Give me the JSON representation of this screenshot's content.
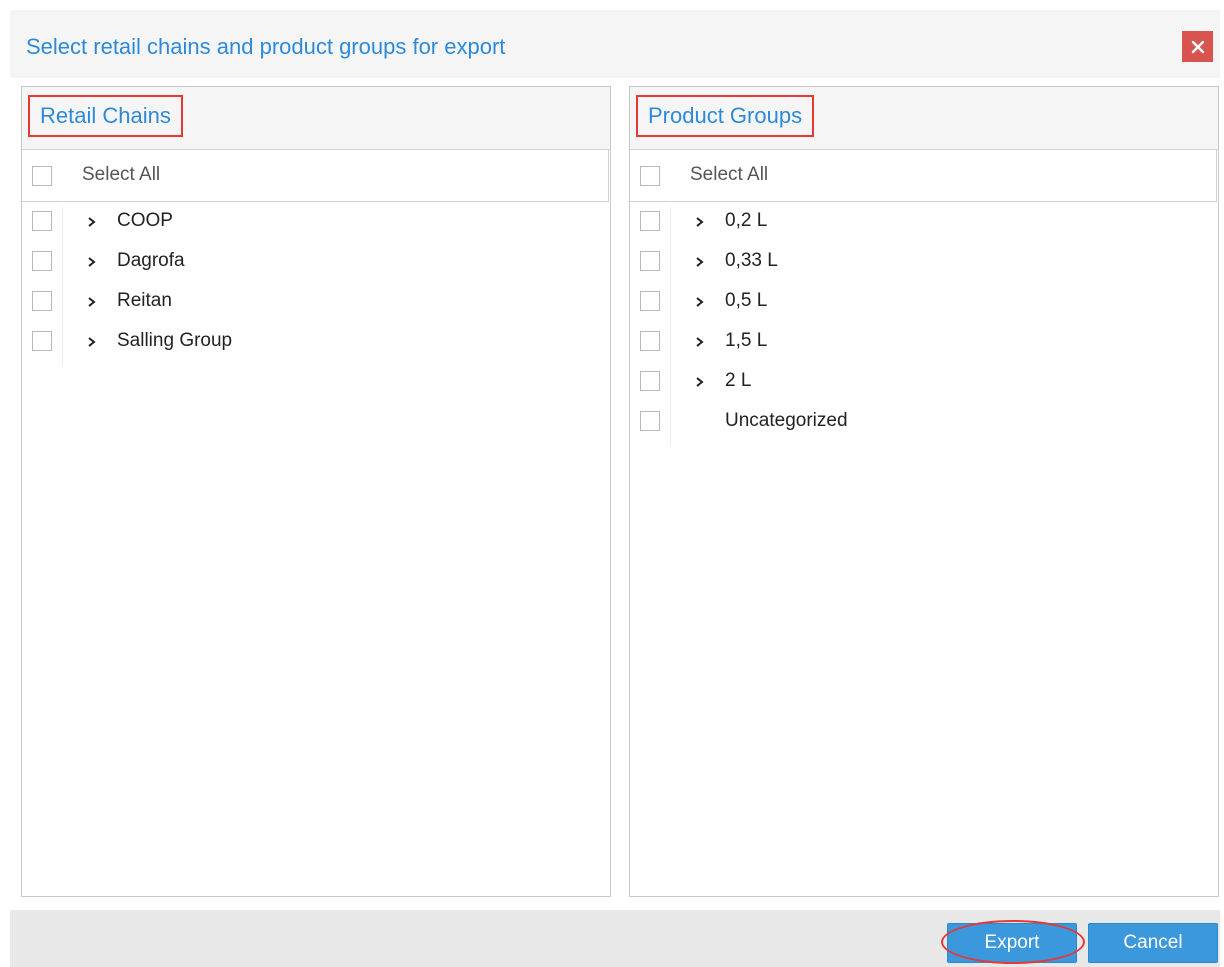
{
  "dialog": {
    "title": "Select retail chains and product groups for export",
    "close_icon": "close-icon",
    "accent_color": "#2e8ad8",
    "close_color": "#d9534f"
  },
  "retail_chains": {
    "title": "Retail Chains",
    "select_all_label": "Select All",
    "items": [
      {
        "label": "COOP",
        "expandable": true
      },
      {
        "label": "Dagrofa",
        "expandable": true
      },
      {
        "label": "Reitan",
        "expandable": true
      },
      {
        "label": "Salling Group",
        "expandable": true
      }
    ]
  },
  "product_groups": {
    "title": "Product Groups",
    "select_all_label": "Select All",
    "items": [
      {
        "label": "0,2 L",
        "expandable": true
      },
      {
        "label": "0,33 L",
        "expandable": true
      },
      {
        "label": "0,5 L",
        "expandable": true
      },
      {
        "label": "1,5 L",
        "expandable": true
      },
      {
        "label": "2 L",
        "expandable": true
      },
      {
        "label": "Uncategorized",
        "expandable": false
      }
    ]
  },
  "footer": {
    "export_label": "Export",
    "cancel_label": "Cancel",
    "button_color": "#3b98dc",
    "highlight_color": "#e53935"
  }
}
